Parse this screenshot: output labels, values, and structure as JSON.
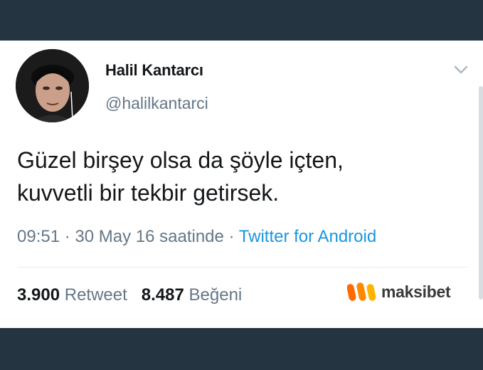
{
  "tweet": {
    "author": {
      "display_name": "Halil Kantarcı",
      "username": "@halilkantarci"
    },
    "text_line1": "Güzel birşey olsa da şöyle içten,",
    "text_line2": "kuvvetli bir tekbir getirsek.",
    "meta": {
      "time": "09:51",
      "separator1": " · ",
      "date": "30 May 16 saatinde",
      "separator2": " · ",
      "source": "Twitter for Android"
    },
    "stats": {
      "retweet_count": "3.900",
      "retweet_label": "Retweet",
      "like_count": "8.487",
      "like_label": "Beğeni"
    }
  },
  "watermark": {
    "text": "maksibet",
    "logo_colors": [
      "#ff6a00",
      "#ff9a00",
      "#ffbe00"
    ]
  },
  "colors": {
    "page_background": "#243441",
    "primary_text": "#14171a",
    "secondary_text": "#657786",
    "link": "#1b95e0"
  },
  "icons": {
    "menu": "chevron-down-icon"
  }
}
